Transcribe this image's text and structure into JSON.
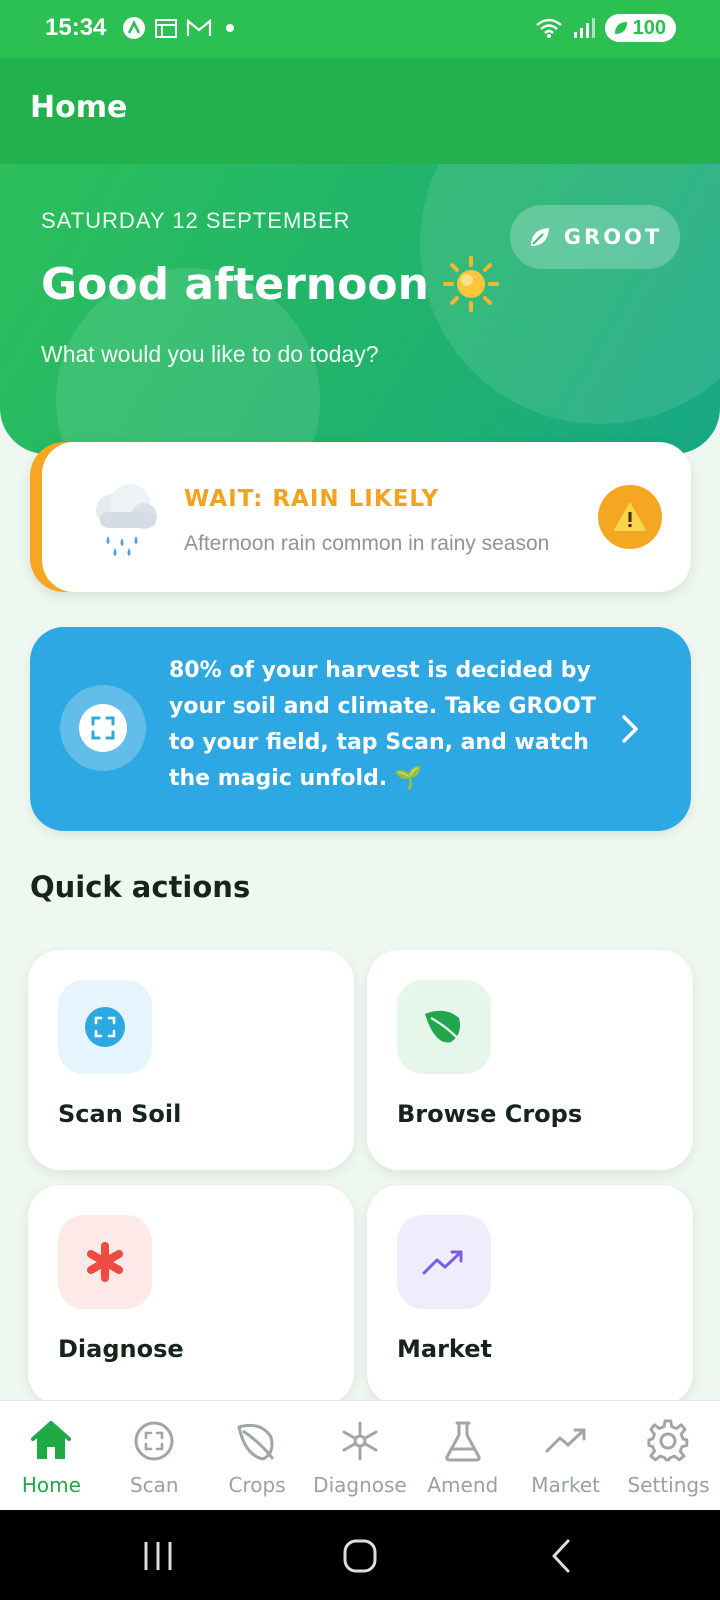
{
  "status_bar": {
    "time": "15:34",
    "battery": "100"
  },
  "app_bar": {
    "title": "Home"
  },
  "hero": {
    "date": "SATURDAY 12 SEPTEMBER",
    "greeting": "Good afternoon",
    "subtitle": "What would you like to do today?",
    "badge": "GROOT"
  },
  "weather_alert": {
    "title": "WAIT: RAIN LIKELY",
    "subtitle": "Afternoon rain common in rainy season",
    "accent": "#f5a623"
  },
  "tip": {
    "text": "80% of your harvest is decided by your soil and climate. Take GROOT to your field, tap Scan, and watch the magic unfold. 🌱",
    "color": "#2ea8e2"
  },
  "quick_actions": {
    "title": "Quick actions",
    "items": [
      {
        "label": "Scan Soil",
        "icon": "scan-icon",
        "bg": "#e6f4fd"
      },
      {
        "label": "Browse Crops",
        "icon": "leaf-icon",
        "bg": "#e6f6ea"
      },
      {
        "label": "Diagnose",
        "icon": "asterisk-icon",
        "bg": "#fde9e8"
      },
      {
        "label": "Market",
        "icon": "trend-icon",
        "bg": "#efedfc"
      }
    ]
  },
  "bottom_nav": {
    "items": [
      {
        "label": "Home",
        "icon": "home-icon",
        "active": true
      },
      {
        "label": "Scan",
        "icon": "scan-icon"
      },
      {
        "label": "Crops",
        "icon": "leaf-icon"
      },
      {
        "label": "Diagnose",
        "icon": "asterisk-icon"
      },
      {
        "label": "Amend",
        "icon": "flask-icon"
      },
      {
        "label": "Market",
        "icon": "trend-icon"
      },
      {
        "label": "Settings",
        "icon": "gear-icon"
      }
    ]
  },
  "colors": {
    "primary": "#22b14c",
    "active_nav": "#1faa46"
  }
}
